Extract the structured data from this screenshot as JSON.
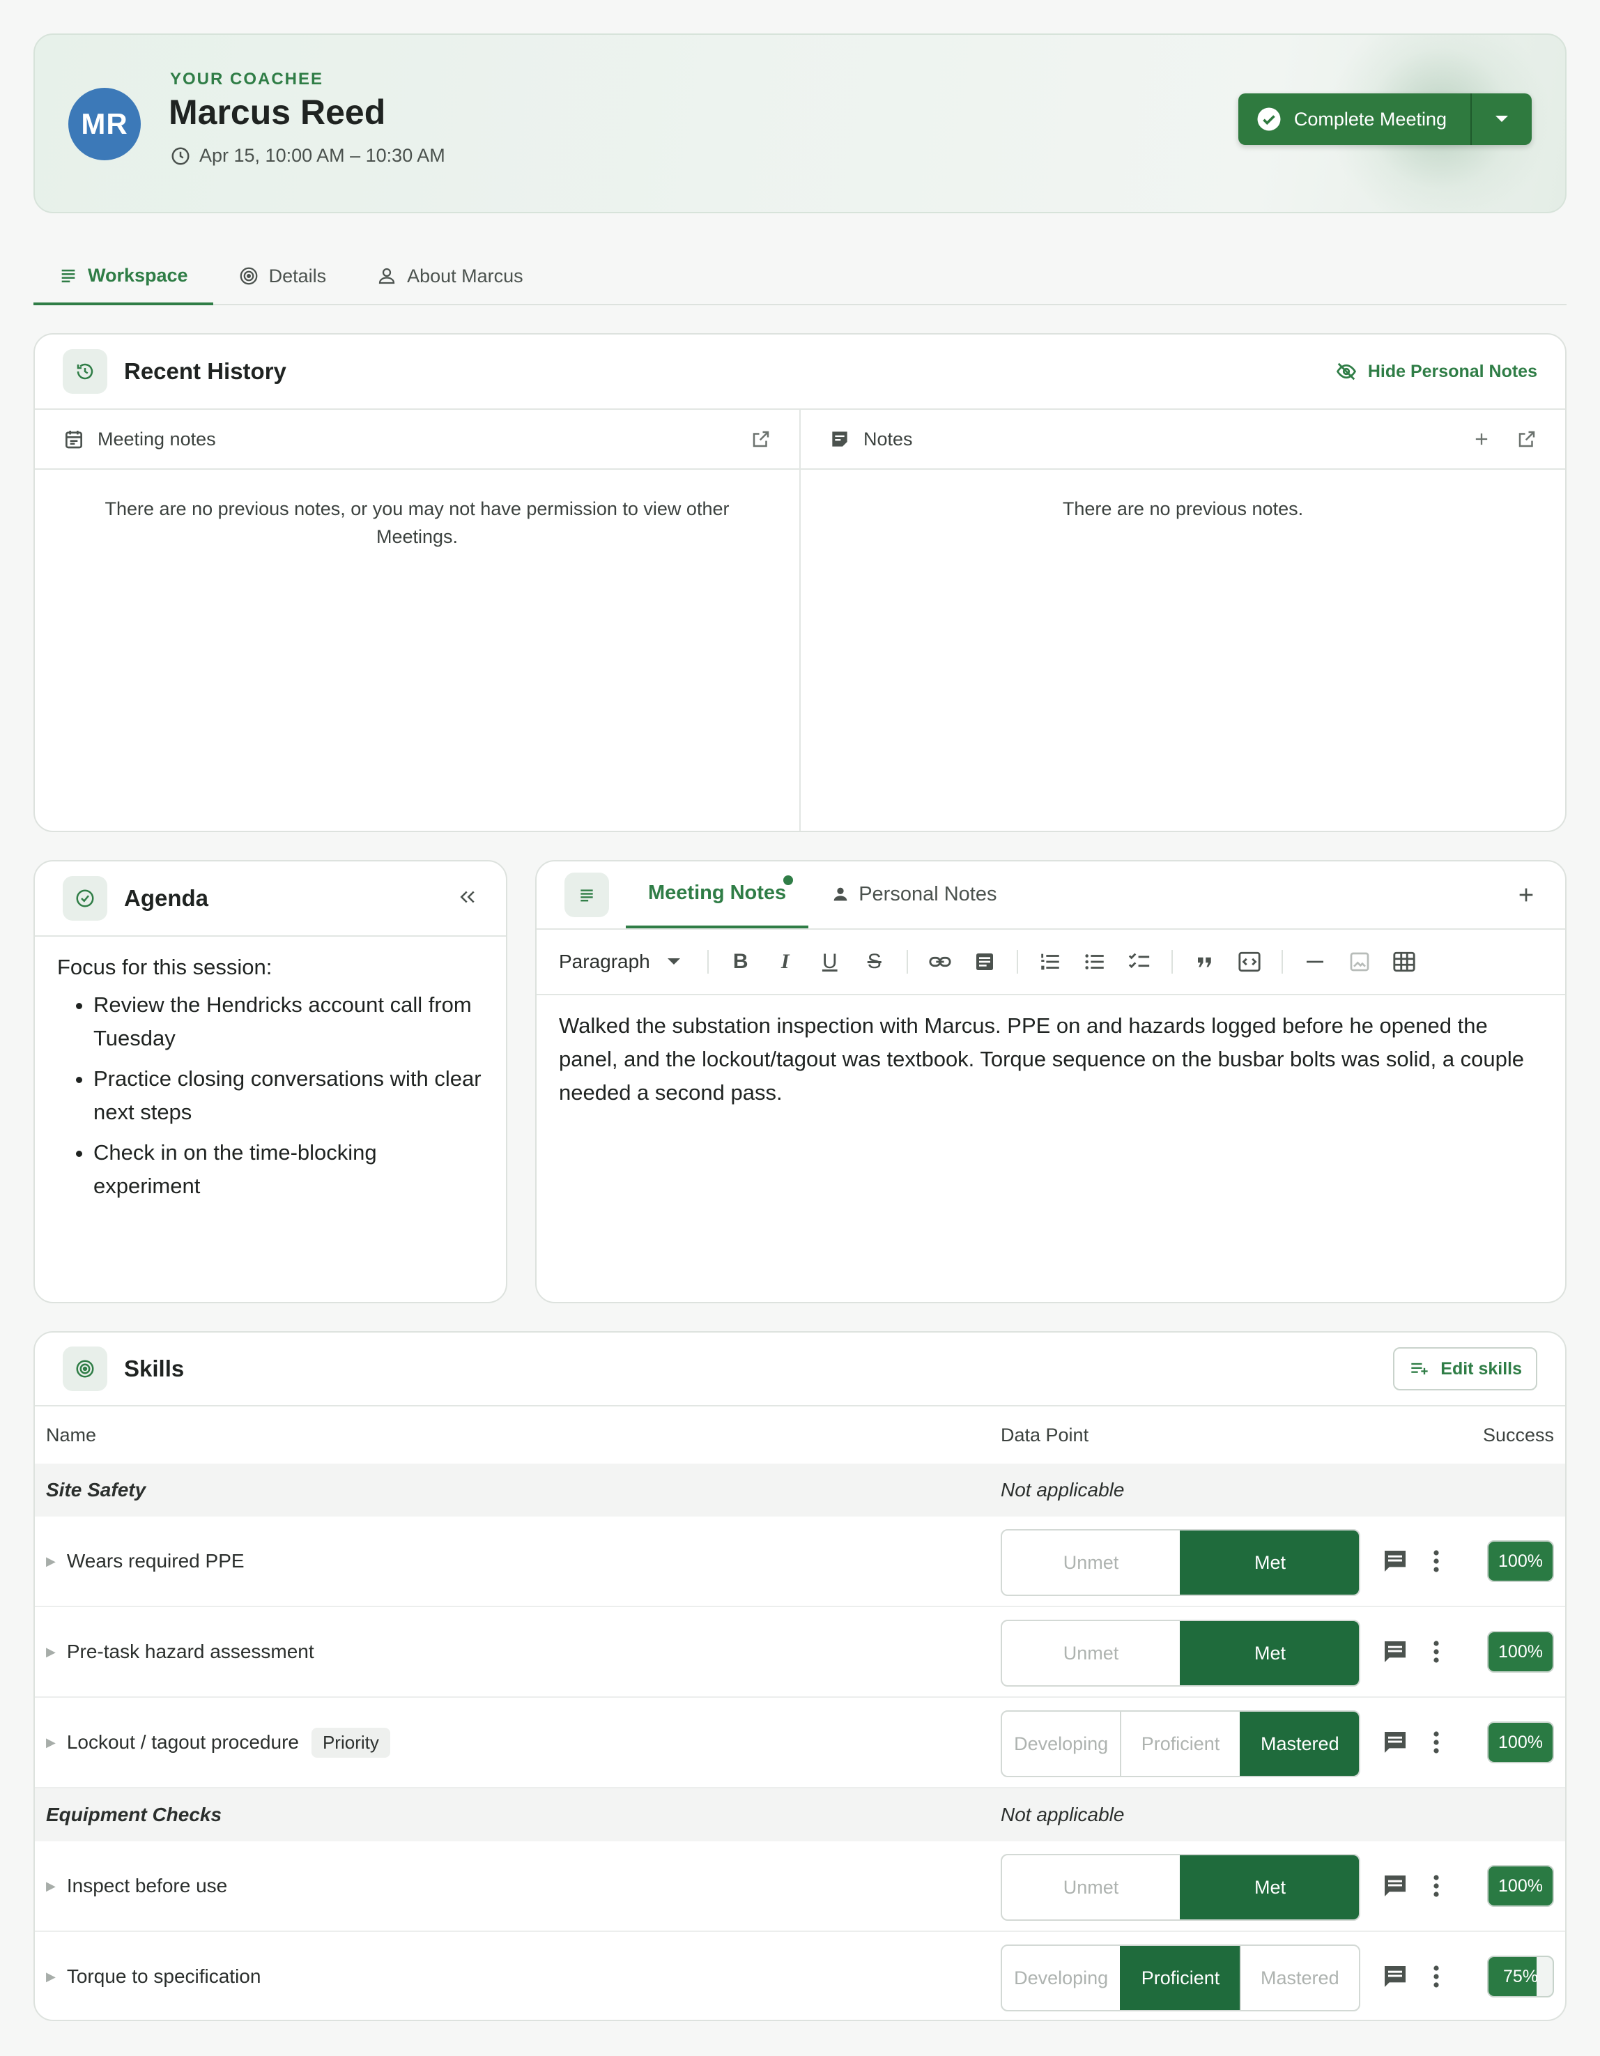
{
  "header": {
    "eyebrow": "YOUR COACHEE",
    "initials": "MR",
    "name": "Marcus Reed",
    "time": "Apr 15, 10:00 AM – 10:30 AM",
    "complete_label": "Complete Meeting"
  },
  "tabs": [
    {
      "label": "Workspace",
      "icon": "notes-lines-icon",
      "active": true
    },
    {
      "label": "Details",
      "icon": "target-icon",
      "active": false
    },
    {
      "label": "About Marcus",
      "icon": "person-icon",
      "active": false
    }
  ],
  "recent_history": {
    "title": "Recent History",
    "hide_label": "Hide Personal Notes",
    "meeting_notes": {
      "label": "Meeting notes",
      "empty": "There are no previous notes, or you may not have permission to view other Meetings."
    },
    "notes": {
      "label": "Notes",
      "empty": "There are no previous notes."
    }
  },
  "agenda": {
    "title": "Agenda",
    "intro": "Focus for this session:",
    "items": [
      "Review the Hendricks account call from Tuesday",
      "Practice closing conversations with clear next steps",
      "Check in on the time-blocking experiment"
    ]
  },
  "editor": {
    "tab_meeting": "Meeting Notes",
    "tab_personal": "Personal Notes",
    "paragraph_label": "Paragraph",
    "toolbar": {
      "bold": "B",
      "italic": "I",
      "underline": "U",
      "strike": "S"
    },
    "text": "Walked the substation inspection with Marcus. PPE on and hazards logged before he opened the panel, and the lockout/tagout was textbook. Torque sequence on the busbar bolts was solid, a couple needed a second pass."
  },
  "skills": {
    "title": "Skills",
    "edit_label": "Edit skills",
    "columns": {
      "name": "Name",
      "data_point": "Data Point",
      "success": "Success"
    },
    "sections": [
      {
        "name": "Site Safety",
        "data_point": "Not applicable",
        "rows": [
          {
            "name": "Wears required PPE",
            "options": [
              "Unmet",
              "Met"
            ],
            "selected": 1,
            "success_label": "100%",
            "success": 1.0
          },
          {
            "name": "Pre-task hazard assessment",
            "options": [
              "Unmet",
              "Met"
            ],
            "selected": 1,
            "success_label": "100%",
            "success": 1.0
          },
          {
            "name": "Lockout / tagout procedure",
            "badge": "Priority",
            "options": [
              "Developing",
              "Proficient",
              "Mastered"
            ],
            "selected": 2,
            "success_label": "100%",
            "success": 1.0
          }
        ]
      },
      {
        "name": "Equipment Checks",
        "data_point": "Not applicable",
        "rows": [
          {
            "name": "Inspect before use",
            "options": [
              "Unmet",
              "Met"
            ],
            "selected": 1,
            "success_label": "100%",
            "success": 1.0
          },
          {
            "name": "Torque to specification",
            "options": [
              "Developing",
              "Proficient",
              "Mastered"
            ],
            "selected": 1,
            "success_label": "75%",
            "success": 0.75
          }
        ]
      }
    ]
  },
  "colors": {
    "accent": "#2f7d46",
    "selected": "#1f6b3c",
    "avatar": "#3c79b8"
  }
}
